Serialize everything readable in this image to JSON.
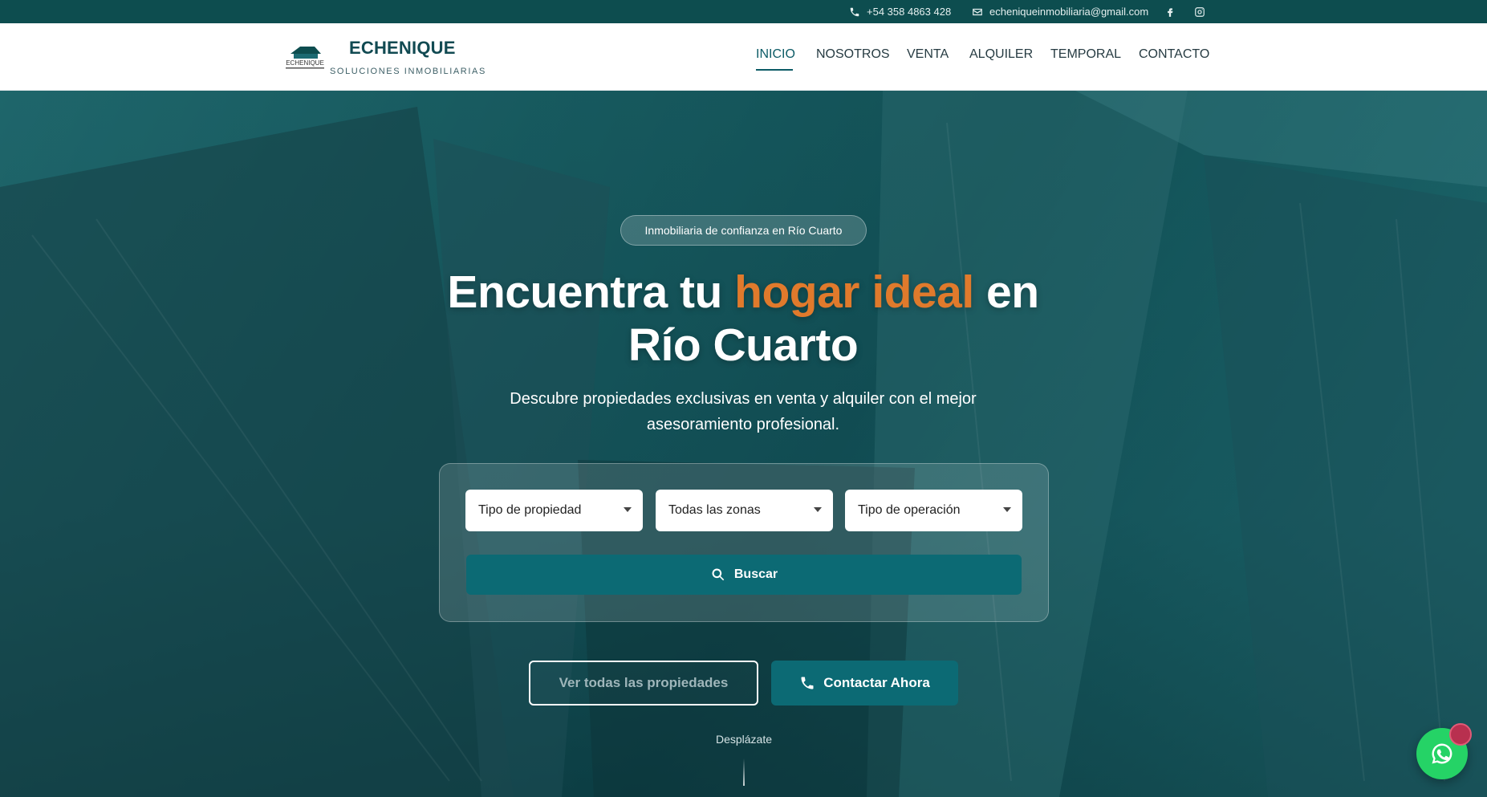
{
  "topbar": {
    "phone": "+54 358 4863 428",
    "email": "echeniqueinmobiliaria@gmail.com",
    "social": [
      "facebook-icon",
      "instagram-icon"
    ]
  },
  "header": {
    "brand_name": "ECHENIQUE",
    "brand_tagline": "SOLUCIONES INMOBILIARIAS",
    "nav": [
      {
        "label": "INICIO",
        "active": true
      },
      {
        "label": "NOSOTROS",
        "active": false
      },
      {
        "label": "VENTA",
        "active": false
      },
      {
        "label": "ALQUILER",
        "active": false
      },
      {
        "label": "TEMPORAL",
        "active": false
      },
      {
        "label": "CONTACTO",
        "active": false
      }
    ]
  },
  "hero": {
    "badge": "Inmobiliaria de confianza en Río Cuarto",
    "title_part1": "Encuentra tu ",
    "title_highlight": "hogar ideal",
    "title_part2": " en",
    "title_line2": "Río Cuarto",
    "subtitle": "Descubre propiedades exclusivas en venta y alquiler con el mejor asesoramiento profesional.",
    "search": {
      "property_type": "Tipo de propiedad",
      "zone": "Todas las zonas",
      "operation": "Tipo de operación",
      "button": "Buscar"
    },
    "cta_all": "Ver todas las propiedades",
    "cta_contact": "Contactar Ahora",
    "scroll_hint": "Desplázate"
  },
  "colors": {
    "primary": "#0c6a74",
    "topbar": "#0d4d4f",
    "highlight": "#e07a2c",
    "whatsapp": "#25d366"
  }
}
